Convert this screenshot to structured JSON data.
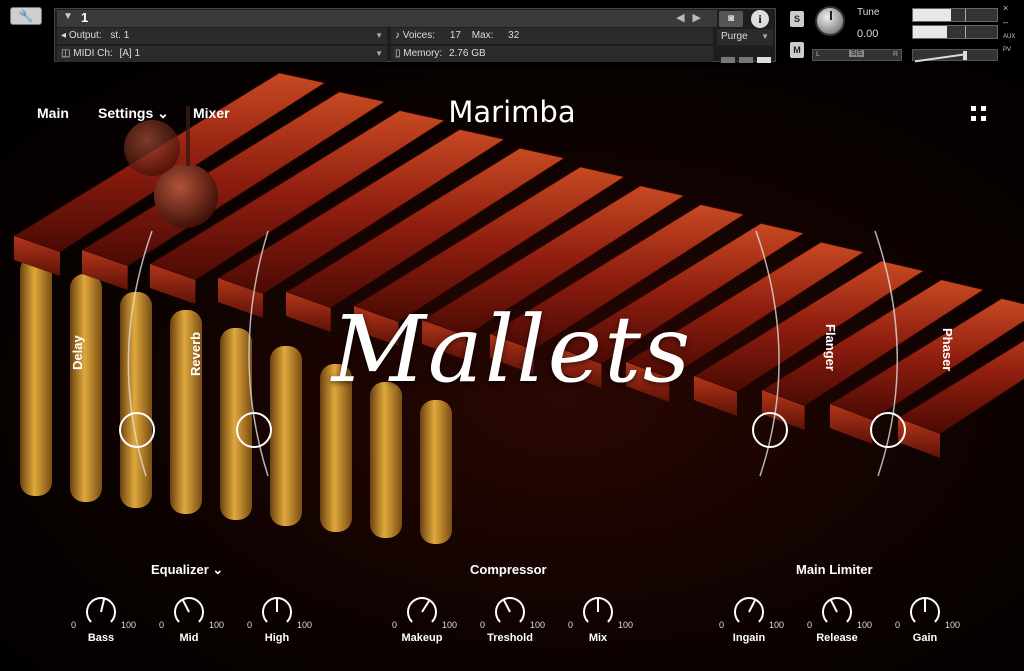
{
  "header": {
    "instrument_name": "1",
    "output_label": "Output:",
    "output_value": "st. 1",
    "voices_label": "Voices:",
    "voices_value": "17",
    "max_label": "Max:",
    "max_value": "32",
    "purge_label": "Purge",
    "midi_label": "MIDI Ch:",
    "midi_value": "[A]  1",
    "memory_label": "Memory:",
    "memory_value": "2.76 GB",
    "solo_label": "S",
    "mute_label": "M",
    "tune_label": "Tune",
    "tune_value": "0.00",
    "pan_left": "L",
    "pan_right": "R",
    "pan_center": "S|S",
    "aux_label": "AUX",
    "pv_label": "PV",
    "close_label": "×",
    "min_label": "–"
  },
  "nav": {
    "main": "Main",
    "settings": "Settings ⌄",
    "mixer": "Mixer"
  },
  "title": "Marimba",
  "logo_text": "Mallets",
  "effects": [
    {
      "label": "Delay"
    },
    {
      "label": "Reverb"
    },
    {
      "label": "Flanger"
    },
    {
      "label": "Phaser"
    }
  ],
  "sections": {
    "equalizer": "Equalizer ⌄",
    "compressor": "Compressor",
    "limiter": "Main Limiter"
  },
  "knobs": [
    {
      "label": "Bass",
      "min": "0",
      "max": "100",
      "value": 55
    },
    {
      "label": "Mid",
      "min": "0",
      "max": "100",
      "value": 40
    },
    {
      "label": "High",
      "min": "0",
      "max": "100",
      "value": 50
    },
    {
      "label": "Makeup",
      "min": "0",
      "max": "100",
      "value": 62
    },
    {
      "label": "Treshold",
      "min": "0",
      "max": "100",
      "value": 40
    },
    {
      "label": "Mix",
      "min": "0",
      "max": "100",
      "value": 50
    },
    {
      "label": "Ingain",
      "min": "0",
      "max": "100",
      "value": 60
    },
    {
      "label": "Release",
      "min": "0",
      "max": "100",
      "value": 40
    },
    {
      "label": "Gain",
      "min": "0",
      "max": "100",
      "value": 50
    }
  ],
  "colors": {
    "bar_wood": "#8e1d0f",
    "bar_highlight": "#c84a22",
    "resonator": "#c9912a",
    "accent": "#ffffff"
  }
}
